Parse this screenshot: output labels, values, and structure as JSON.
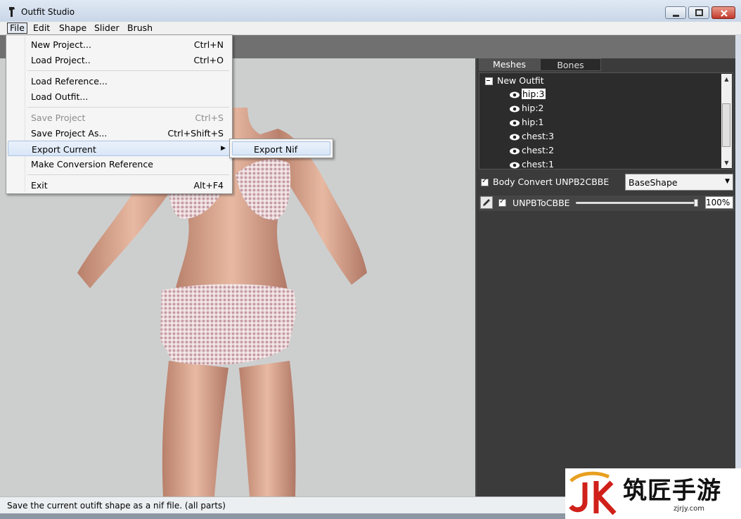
{
  "window": {
    "title": "Outfit Studio",
    "app_icon": "outfit-studio-icon",
    "controls": [
      "minimize-icon",
      "maximize-icon",
      "close-icon"
    ]
  },
  "menubar": {
    "items": [
      "File",
      "Edit",
      "Shape",
      "Slider",
      "Brush"
    ],
    "active": "File"
  },
  "file_menu": {
    "items": [
      {
        "label": "New Project...",
        "shortcut": "Ctrl+N"
      },
      {
        "label": "Load Project..",
        "shortcut": "Ctrl+O"
      },
      {
        "label": "Load Reference...",
        "shortcut": ""
      },
      {
        "label": "Load Outfit...",
        "shortcut": ""
      },
      {
        "label": "Save Project",
        "shortcut": "Ctrl+S",
        "disabled": true
      },
      {
        "label": "Save Project As...",
        "shortcut": "Ctrl+Shift+S"
      },
      {
        "label": "Export Current",
        "shortcut": "",
        "submenu": true,
        "highlighted": true
      },
      {
        "label": "Make Conversion Reference",
        "shortcut": ""
      },
      {
        "label": "Exit",
        "shortcut": "Alt+F4"
      }
    ],
    "export_submenu": {
      "items": [
        "Export Nif"
      ]
    }
  },
  "right_panel": {
    "tabs": [
      "Meshes",
      "Bones"
    ],
    "active_tab": "Meshes",
    "tree": {
      "root": "New Outfit",
      "items": [
        "hip:3",
        "hip:2",
        "hip:1",
        "chest:3",
        "chest:2",
        "chest:1"
      ],
      "selected": "hip:3",
      "item_icon": "eye-icon"
    },
    "slider_set": {
      "checked": true,
      "label": "Body Convert UNPB2CBBE",
      "shape_dropdown": "BaseShape"
    },
    "sliders": [
      {
        "name": "UNPBToCBBE",
        "checked": true,
        "value_label": "100%",
        "value": 100,
        "edit_icon": "pencil-icon"
      }
    ]
  },
  "status": {
    "text": "Save the current outift shape as a nif file. (all parts)"
  },
  "watermark": {
    "text": "筑匠手游",
    "url": "zjrjy.com",
    "logo": "jk-logo"
  },
  "colors": {
    "panel_bg": "#3b3b3b",
    "viewport_bg": "#cdcfcf",
    "toolbar_bg": "#707070",
    "menu_highlight": "#d9e6f7"
  }
}
